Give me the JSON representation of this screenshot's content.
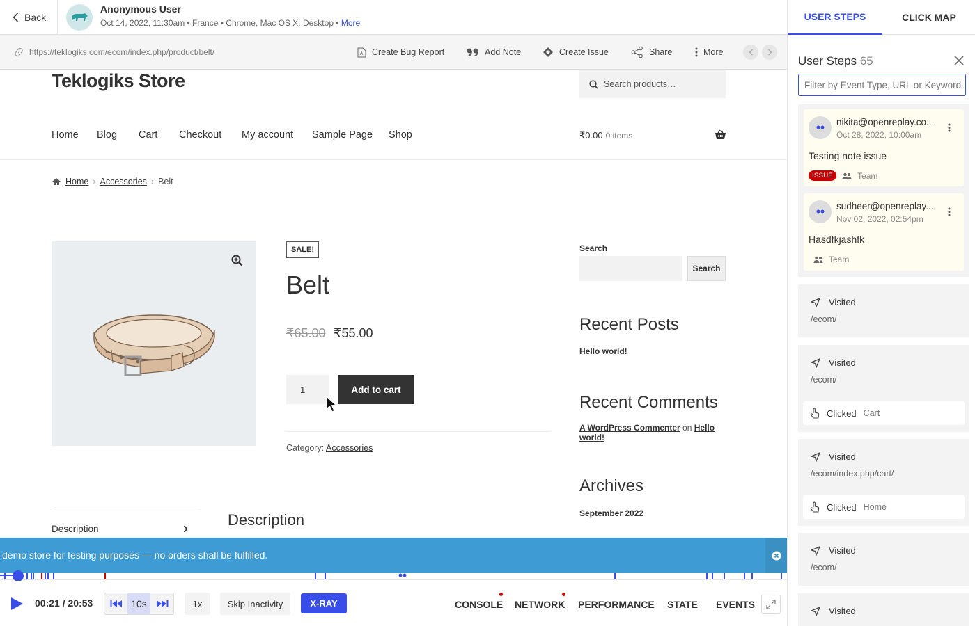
{
  "header": {
    "back_label": "Back",
    "user_name": "Anonymous User",
    "meta": "Oct 14, 2022, 11:30am • France • Chrome, Mac OS X, Desktop •",
    "more_label": "More"
  },
  "urlbar": {
    "url": "https://teklogiks.com/ecom/index.php/product/belt/",
    "actions": {
      "bug_report": "Create Bug Report",
      "add_note": "Add Note",
      "create_issue": "Create Issue",
      "share": "Share",
      "more": "More"
    }
  },
  "store": {
    "title": "Teklogiks Store",
    "search_placeholder": "Search products…",
    "menu": [
      "Home",
      "Blog",
      "Cart",
      "Checkout",
      "My account",
      "Sample Page",
      "Shop"
    ],
    "cart_amount": "₹0.00",
    "cart_items": "0 items",
    "breadcrumb": {
      "home": "Home",
      "sep": "›",
      "category": "Accessories",
      "current": "Belt"
    },
    "sale_badge": "SALE!",
    "product_title": "Belt",
    "old_price": "₹65.00",
    "new_price": "₹55.00",
    "qty": "1",
    "add_to_cart": "Add to cart",
    "category_label": "Category:",
    "category_value": "Accessories",
    "desc_tab": "Description",
    "desc_heading": "Description",
    "sidebar": {
      "search_label": "Search",
      "search_button": "Search",
      "recent_posts_heading": "Recent Posts",
      "recent_post": "Hello world!",
      "recent_comments_heading": "Recent Comments",
      "commenter": "A WordPress Commenter",
      "comment_on": "on",
      "comment_post": "Hello world!",
      "archives_heading": "Archives",
      "archive": "September 2022"
    }
  },
  "notice": {
    "text": "demo store for testing purposes — no orders shall be fulfilled."
  },
  "player": {
    "time": "00:21 / 20:53",
    "skip_interval": "10s",
    "speed": "1x",
    "skip_inactivity": "Skip Inactivity",
    "xray": "X-RAY",
    "progress_fraction": 0.017,
    "tabs": [
      "CONSOLE",
      "NETWORK",
      "PERFORMANCE",
      "STATE",
      "EVENTS"
    ]
  },
  "panel": {
    "tabs": [
      "USER STEPS",
      "CLICK MAP"
    ],
    "title": "User Steps",
    "count": "65",
    "filter_placeholder": "Filter by Event Type, URL or Keyword",
    "notes": [
      {
        "email": "nikita@openreplay.co...",
        "date": "Oct 28, 2022, 10:00am",
        "text": "Testing note issue",
        "badge": "ISSUE",
        "scope": "Team"
      },
      {
        "email": "sudheer@openreplay....",
        "date": "Nov 02, 2022, 02:54pm",
        "text": "Hasdfkjashfk",
        "badge": "",
        "scope": "Team"
      }
    ],
    "visited_label": "Visited",
    "clicked_label": "Clicked",
    "events": [
      {
        "url": "/ecom/"
      },
      {
        "url": "/ecom/",
        "click": "Cart"
      },
      {
        "url": "/ecom/index.php/cart/",
        "click": "Home"
      },
      {
        "url": "/ecom/"
      },
      {
        "url": ""
      }
    ]
  },
  "colors": {
    "accent": "#394ee9",
    "notice": "#3f9bd3",
    "issue": "#cc0000",
    "note_bg": "#fffdf0"
  }
}
